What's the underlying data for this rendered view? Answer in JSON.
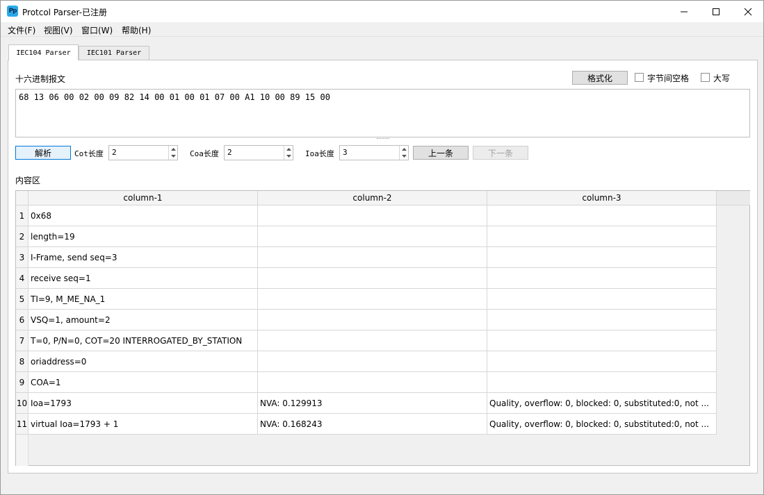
{
  "window": {
    "title": "Protcol Parser-已注册",
    "icon_text": "Pp"
  },
  "menu": {
    "items": [
      "文件(F)",
      "视图(V)",
      "窗口(W)",
      "帮助(H)"
    ]
  },
  "tabs": [
    {
      "label": "IEC104 Parser",
      "active": true
    },
    {
      "label": "IEC101 Parser",
      "active": false
    }
  ],
  "hex_section": {
    "label": "十六进制报文",
    "format_button": "格式化",
    "byte_space_label": "字节间空格",
    "uppercase_label": "大写",
    "byte_space_checked": false,
    "uppercase_checked": false,
    "content": "68 13 06 00 02 00 09 82 14 00 01 00 01 07 00 A1 10 00 89 15 00"
  },
  "controls": {
    "parse_button": "解析",
    "cot_label": "Cot长度",
    "cot_value": "2",
    "coa_label": "Coa长度",
    "coa_value": "2",
    "ioa_label": "Ioa长度",
    "ioa_value": "3",
    "prev_button": "上一条",
    "next_button": "下一条",
    "next_enabled": false
  },
  "content_section": {
    "label": "内容区",
    "columns": [
      "column-1",
      "column-2",
      "column-3"
    ],
    "rows": [
      {
        "num": "1",
        "c1": "0x68",
        "c2": "",
        "c3": ""
      },
      {
        "num": "2",
        "c1": "length=19",
        "c2": "",
        "c3": ""
      },
      {
        "num": "3",
        "c1": "I-Frame, send seq=3",
        "c2": "",
        "c3": ""
      },
      {
        "num": "4",
        "c1": "receive seq=1",
        "c2": "",
        "c3": ""
      },
      {
        "num": "5",
        "c1": "TI=9, M_ME_NA_1",
        "c2": "",
        "c3": ""
      },
      {
        "num": "6",
        "c1": "VSQ=1, amount=2",
        "c2": "",
        "c3": ""
      },
      {
        "num": "7",
        "c1": "T=0, P/N=0, COT=20 INTERROGATED_BY_STATION",
        "c2": "",
        "c3": ""
      },
      {
        "num": "8",
        "c1": "oriaddress=0",
        "c2": "",
        "c3": ""
      },
      {
        "num": "9",
        "c1": "COA=1",
        "c2": "",
        "c3": ""
      },
      {
        "num": "10",
        "c1": "Ioa=1793",
        "c2": "NVA: 0.129913",
        "c3": "Quality, overflow: 0, blocked: 0, substituted:0, not ..."
      },
      {
        "num": "11",
        "c1": "virtual Ioa=1793 + 1",
        "c2": "NVA: 0.168243",
        "c3": "Quality, overflow: 0, blocked: 0, substituted:0, not ..."
      }
    ]
  }
}
